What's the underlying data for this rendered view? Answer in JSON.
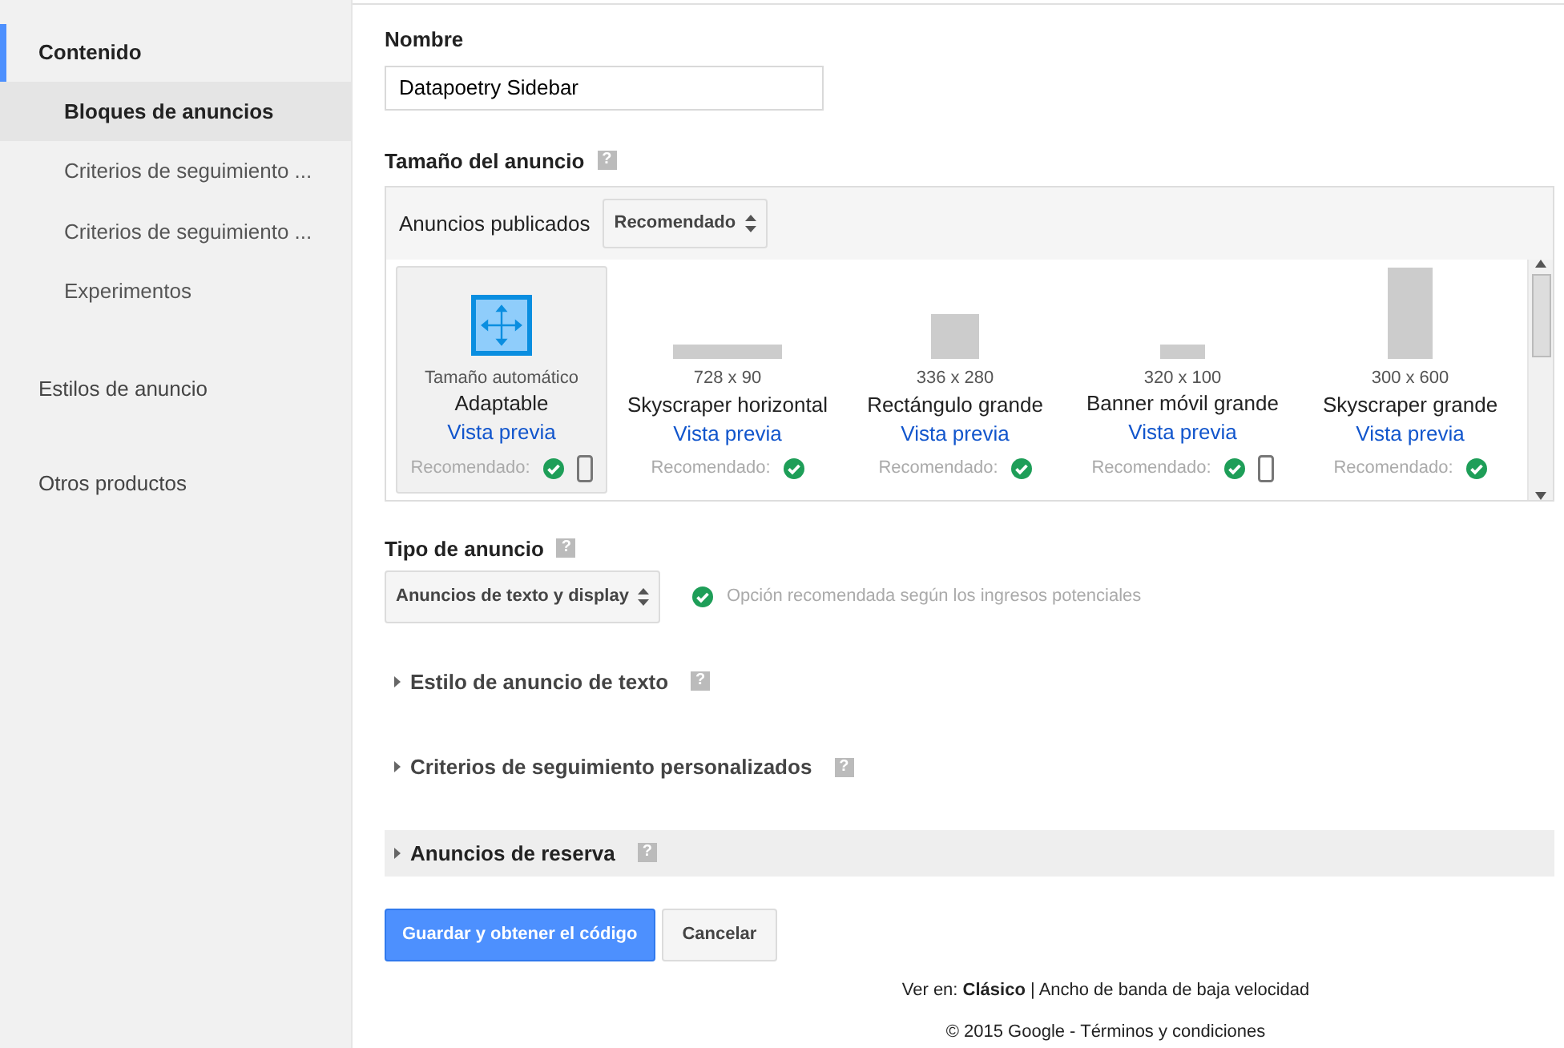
{
  "sidebar": {
    "sections": [
      {
        "label": "Contenido",
        "selected": true,
        "children": [
          {
            "label": "Bloques de anuncios",
            "selected": true
          },
          {
            "label": "Criterios de seguimiento ...",
            "selected": false
          },
          {
            "label": "Criterios de seguimiento ...",
            "selected": false
          },
          {
            "label": "Experimentos",
            "selected": false
          }
        ]
      },
      {
        "label": "Estilos de anuncio",
        "selected": false
      },
      {
        "label": "Otros productos",
        "selected": false
      }
    ]
  },
  "name_field": {
    "label": "Nombre",
    "value": "Datapoetry Sidebar"
  },
  "ad_size": {
    "label": "Tamaño del anuncio",
    "help": "?",
    "filter_label": "Anuncios publicados",
    "filter_value": "Recomendado",
    "sizes": [
      {
        "kind": "auto",
        "size": "Tamaño automático",
        "name": "Adaptable",
        "preview": "Vista previa",
        "recommended_label": "Recomendado:",
        "selected": true,
        "mobile": true
      },
      {
        "kind": "fixed",
        "size": "728 x 90",
        "name": "Skyscraper horizontal",
        "preview": "Vista previa",
        "recommended_label": "Recomendado:",
        "selected": false,
        "mobile": false
      },
      {
        "kind": "fixed",
        "size": "336 x 280",
        "name": "Rectángulo grande",
        "preview": "Vista previa",
        "recommended_label": "Recomendado:",
        "selected": false,
        "mobile": false
      },
      {
        "kind": "fixed",
        "size": "320 x 100",
        "name": "Banner móvil grande",
        "preview": "Vista previa",
        "recommended_label": "Recomendado:",
        "selected": false,
        "mobile": true
      },
      {
        "kind": "fixed",
        "size": "300 x 600",
        "name": "Skyscraper grande",
        "preview": "Vista previa",
        "recommended_label": "Recomendado:",
        "selected": false,
        "mobile": false
      }
    ]
  },
  "ad_type": {
    "label": "Tipo de anuncio",
    "help": "?",
    "value": "Anuncios de texto y display",
    "note": "Opción recomendada según los ingresos potenciales"
  },
  "sections": [
    {
      "label": "Estilo de anuncio de texto",
      "help": "?",
      "highlighted": false
    },
    {
      "label": "Criterios de seguimiento personalizados",
      "help": "?",
      "highlighted": false
    },
    {
      "label": "Anuncios de reserva",
      "help": "?",
      "highlighted": true
    }
  ],
  "buttons": [
    {
      "label": "Guardar y obtener el código",
      "kind": "primary"
    },
    {
      "label": "Cancelar",
      "kind": "secondary"
    }
  ],
  "footer": {
    "view_text": "Ver en: **Clásico** | ",
    "view_link": "Ancho de banda de baja velocidad",
    "copyright": "© 2015 Google - ",
    "terms_link": "Términos y condiciones"
  }
}
